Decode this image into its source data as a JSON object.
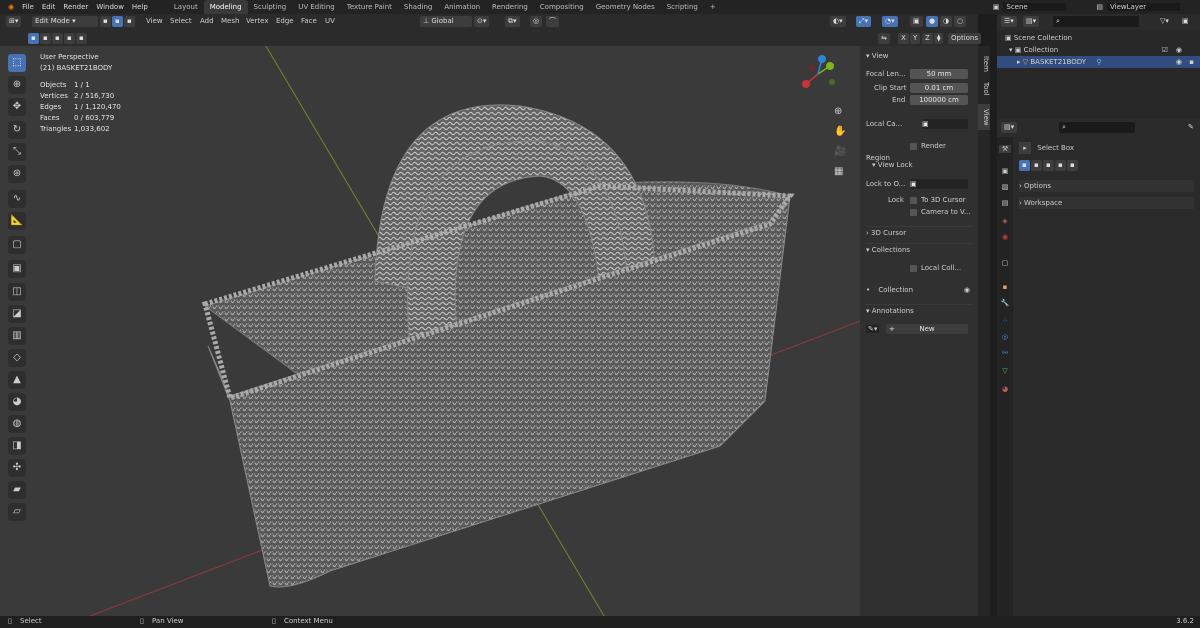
{
  "menu": [
    "File",
    "Edit",
    "Render",
    "Window",
    "Help"
  ],
  "workspaces": [
    "Layout",
    "Modeling",
    "Sculpting",
    "UV Editing",
    "Texture Paint",
    "Shading",
    "Animation",
    "Rendering",
    "Compositing",
    "Geometry Nodes",
    "Scripting",
    "+"
  ],
  "active_workspace": "Modeling",
  "scene": "Scene",
  "view_layer": "ViewLayer",
  "header": {
    "mode": "Edit Mode",
    "menus": [
      "View",
      "Select",
      "Add",
      "Mesh",
      "Vertex",
      "Edge",
      "Face",
      "UV"
    ],
    "orientation": "Global",
    "options": "Options",
    "axes": [
      "X",
      "Y",
      "Z"
    ]
  },
  "overlay": {
    "title": "User Perspective",
    "object": "(21) BASKET21BODY",
    "stats": [
      {
        "label": "Objects",
        "value": "1 / 1"
      },
      {
        "label": "Vertices",
        "value": "2 / 516,730"
      },
      {
        "label": "Edges",
        "value": "1 / 1,120,470"
      },
      {
        "label": "Faces",
        "value": "0 / 603,779"
      },
      {
        "label": "Triangles",
        "value": "1,033,602"
      }
    ]
  },
  "gizmo": {
    "x": "X",
    "y": "Y",
    "z": "Z"
  },
  "npanel": {
    "section_view": "View",
    "focal_label": "Focal Len...",
    "focal_value": "50 mm",
    "clip_start_label": "Clip Start",
    "clip_start_value": "0.01 cm",
    "end_label": "End",
    "end_value": "100000 cm",
    "local_camera_label": "Local Ca...",
    "render_region": "Render Region",
    "view_lock": "View Lock",
    "lock_to_object": "Lock to O...",
    "lock_label": "Lock",
    "to_3d_cursor": "To 3D Cursor",
    "camera_to_view": "Camera to V...",
    "cursor_section": "3D Cursor",
    "collections_section": "Collections",
    "local_collections": "Local Coll...",
    "collection_item": "Collection",
    "annotations_section": "Annotations",
    "new_label": "New"
  },
  "side_tabs": [
    "Item",
    "Tool",
    "View"
  ],
  "outliner": {
    "root": "Scene Collection",
    "collection": "Collection",
    "object": "BASKET21BODY"
  },
  "properties": {
    "tool": "Select Box",
    "options": "Options",
    "workspace": "Workspace"
  },
  "statusbar": {
    "select": "Select",
    "pan": "Pan View",
    "context": "Context Menu",
    "version": "3.6.2"
  },
  "colors": {
    "accent": "#4772b3",
    "x_axis": "#c8343a",
    "y_axis": "#7fb51f",
    "z_axis": "#2d84d9"
  }
}
